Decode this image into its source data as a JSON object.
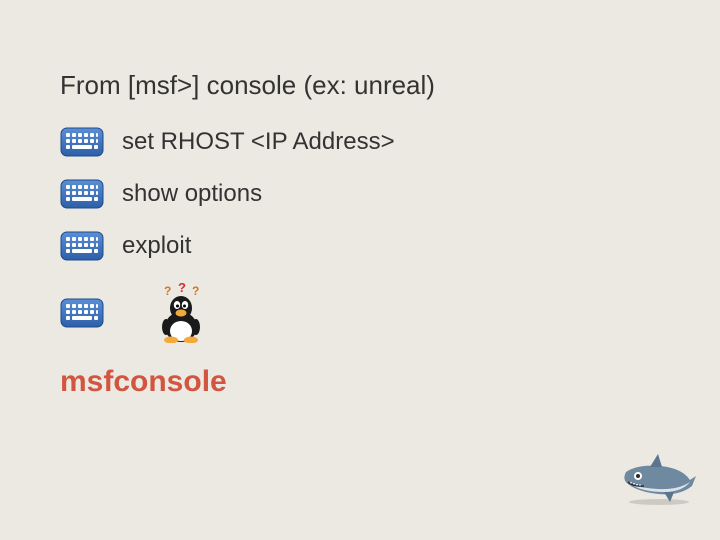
{
  "heading": "From [msf>] console (ex: unreal)",
  "commands": {
    "cmd1": "set RHOST <IP Address>",
    "cmd2": "show options",
    "cmd3": "exploit"
  },
  "title": "msfconsole",
  "icons": {
    "keyboard": "keyboard-icon",
    "tux_confused": "tux-confused-icon",
    "shark": "shark-icon"
  }
}
